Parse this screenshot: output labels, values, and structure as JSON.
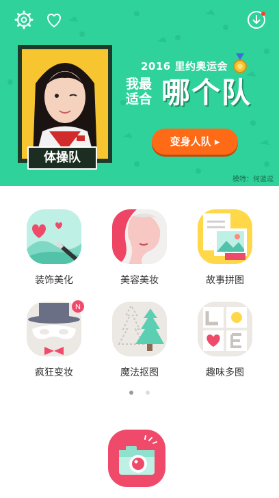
{
  "banner": {
    "year_title": "2016 里约奥运会",
    "question_small": "我最适合",
    "question_big": "哪个队",
    "team_badge": "体操队",
    "transform_button": "变身人队 ▸",
    "model_credit": "模特：何蓝逗",
    "bg_color": "#2fd29a",
    "accent_color": "#ff6a17"
  },
  "top_icons": {
    "settings": "gear-icon",
    "favorite": "heart-icon",
    "download": "download-icon"
  },
  "features": [
    {
      "label": "装饰美化",
      "icon": "decorate-icon"
    },
    {
      "label": "美容美妆",
      "icon": "makeup-icon"
    },
    {
      "label": "故事拼图",
      "icon": "story-collage-icon"
    },
    {
      "label": "疯狂变妆",
      "icon": "crazy-makeover-icon",
      "badge": "N"
    },
    {
      "label": "魔法抠图",
      "icon": "magic-cutout-icon"
    },
    {
      "label": "趣味多图",
      "icon": "fun-multi-image-icon"
    }
  ],
  "pagination": {
    "pages": 2,
    "current": 1
  },
  "camera": {
    "icon": "camera-icon",
    "color": "#f04a6a"
  }
}
